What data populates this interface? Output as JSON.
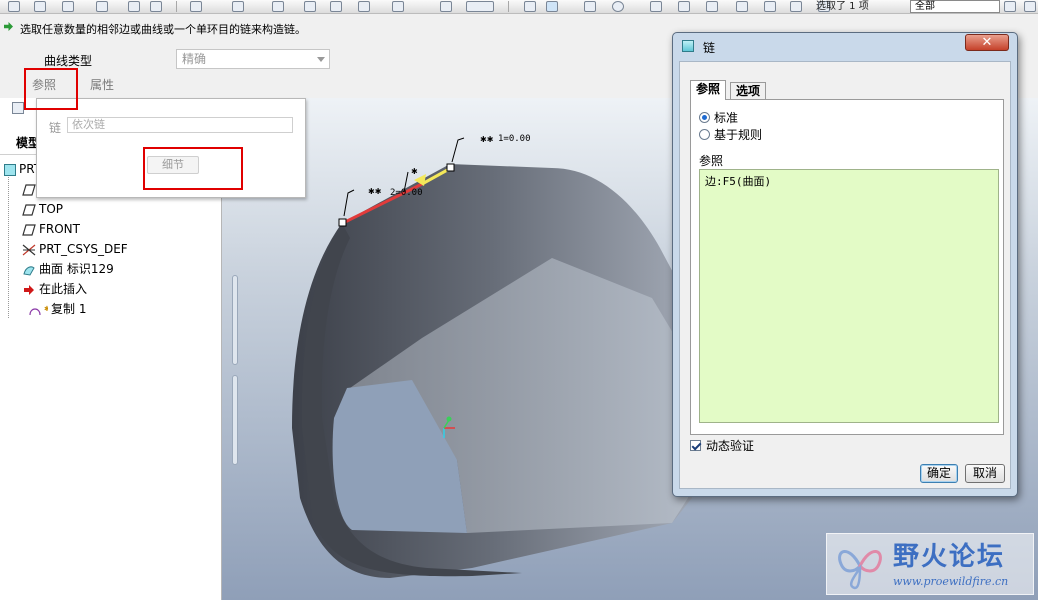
{
  "toolbar": {
    "selection_status": "选取了 1 项",
    "filter_value": "全部"
  },
  "dashboard": {
    "prompt": "选取任意数量的相邻边或曲线或一个单环目的链来构造链。",
    "curve_type_label": "曲线类型",
    "curve_type_value": "精确",
    "tabs": [
      {
        "label": "参照"
      },
      {
        "label": "属性"
      }
    ]
  },
  "ref_popup": {
    "chain_label": "链",
    "chain_placeholder": "依次链",
    "detail_button": "细节"
  },
  "model_tree": {
    "title": "模型",
    "items": [
      {
        "label": "PRT"
      },
      {
        "label": ""
      },
      {
        "label": "TOP"
      },
      {
        "label": "FRONT"
      },
      {
        "label": "PRT_CSYS_DEF"
      },
      {
        "label": "曲面 标识129"
      },
      {
        "label": "在此插入"
      },
      {
        "label": "复制 1"
      }
    ]
  },
  "viewport": {
    "dim_1": "1=0.00",
    "dim_2": "2=0.00"
  },
  "dialog": {
    "title": "链",
    "close_label": "✕",
    "tabs": [
      {
        "label": "参照"
      },
      {
        "label": "选项"
      }
    ],
    "radio_standard": "标准",
    "radio_rule": "基于规则",
    "references_label": "参照",
    "reference_item": "边:F5(曲面)",
    "dynamic_verify": "动态验证",
    "ok_button": "确定",
    "cancel_button": "取消"
  },
  "watermark": {
    "title": "野火论坛",
    "url": "www.proewildfire.cn"
  },
  "colors": {
    "highlight_red": "#e00000",
    "reference_bg": "#e3fbc6",
    "dialog_frame": "#c9d9ea",
    "selected_edge": "#e23b3b",
    "preview_edge": "#f4e85a"
  }
}
